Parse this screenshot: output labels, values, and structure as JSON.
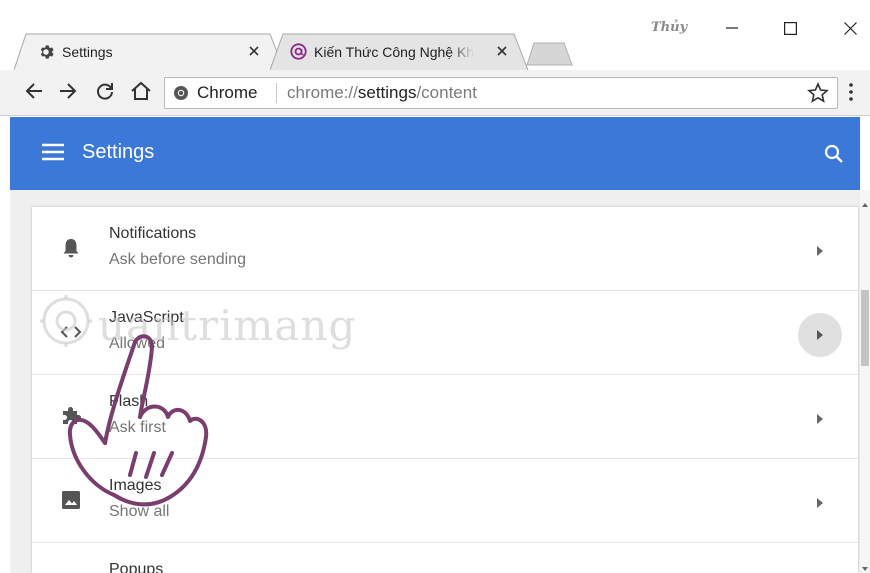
{
  "window": {
    "user_label": "Thủy",
    "minimize_icon": "minimize-icon",
    "maximize_icon": "maximize-icon",
    "close_icon": "close-icon"
  },
  "tabs": [
    {
      "label": "Settings",
      "icon": "gear-icon",
      "active": true
    },
    {
      "label": "Kiến Thức Công Nghệ Kh",
      "icon": "at-sign-icon",
      "active": false
    }
  ],
  "toolbar": {
    "chip_label": "Chrome",
    "url_scheme": "chrome://",
    "url_host": "settings",
    "url_path": "/content"
  },
  "header": {
    "title": "Settings"
  },
  "settings_rows": [
    {
      "title": "Notifications",
      "subtitle": "Ask before sending",
      "icon": "bell-icon"
    },
    {
      "title": "JavaScript",
      "subtitle": "Allowed",
      "icon": "code-icon",
      "hovered": true
    },
    {
      "title": "Flash",
      "subtitle": "Ask first",
      "icon": "puzzle-icon"
    },
    {
      "title": "Images",
      "subtitle": "Show all",
      "icon": "image-icon"
    },
    {
      "title": "Popups",
      "subtitle": "",
      "icon": "popup-icon"
    }
  ],
  "watermark": {
    "text": "uantrimang"
  },
  "colors": {
    "header_blue": "#3c78d8",
    "hand_stroke": "#7a3e6e",
    "watermark": "#d0d0d0"
  }
}
